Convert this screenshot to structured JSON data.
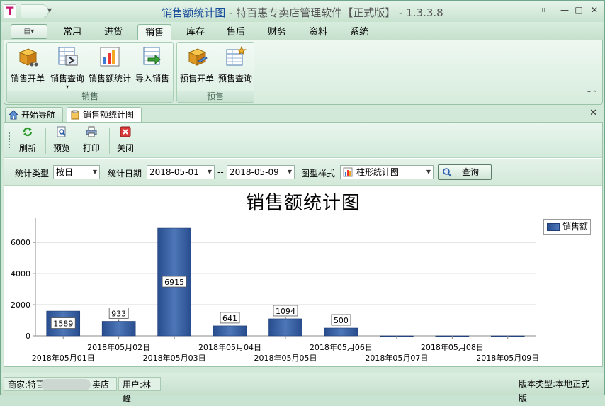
{
  "app": {
    "title_main": "销售额统计图",
    "title_rest": " - 特百惠专卖店管理软件【正式版】 - 1.3.3.8",
    "logo_letter": "T"
  },
  "window_buttons": [
    "⌗",
    "—",
    "□",
    "✕"
  ],
  "menu": {
    "app_button": "▤▾",
    "tabs": [
      "常用",
      "进货",
      "销售",
      "库存",
      "售后",
      "财务",
      "资料",
      "系统"
    ],
    "active_tab": "销售"
  },
  "ribbon": {
    "groups": [
      {
        "label": "销售",
        "buttons": [
          "销售开单",
          "销售查询",
          "销售额统计",
          "导入销售"
        ]
      },
      {
        "label": "预售",
        "buttons": [
          "预售开单",
          "预售查询"
        ]
      }
    ],
    "dropdown_caret": "▾",
    "collapse_icon": "⌃⌃"
  },
  "doc_tabs": [
    "开始导航",
    "销售额统计图"
  ],
  "doc_close": "✕",
  "toolbar": {
    "buttons": [
      "刷新",
      "预览",
      "打印",
      "关闭"
    ]
  },
  "filter": {
    "type_label": "统计类型",
    "type_value": "按日",
    "date_label": "统计日期",
    "date_from": "2018-05-01",
    "date_sep": "--",
    "date_to": "2018-05-09",
    "style_label": "图型样式",
    "style_value": "柱形统计图",
    "query_button": "查询"
  },
  "chart_data": {
    "type": "bar",
    "title": "销售额统计图",
    "categories": [
      "2018年05月01日",
      "2018年05月02日",
      "2018年05月03日",
      "2018年05月04日",
      "2018年05月05日",
      "2018年05月06日",
      "2018年05月07日",
      "2018年05月08日",
      "2018年05月09日"
    ],
    "series": [
      {
        "name": "销售额",
        "values": [
          1589,
          933,
          6915,
          641,
          1094,
          500,
          0,
          0,
          0
        ]
      }
    ],
    "data_labels": [
      "1589",
      "933",
      "6915",
      "641",
      "1094",
      "500",
      "",
      "",
      ""
    ],
    "yticks": [
      0,
      2000,
      4000,
      6000
    ],
    "ylim": [
      0,
      7600
    ],
    "grid": true,
    "legend": "top-right",
    "color": "#3a62a6"
  },
  "status": {
    "merchant_prefix": "商家:特百",
    "merchant_suffix": "卖店",
    "user": "用户:林峰",
    "version": "版本类型:本地正式版"
  }
}
